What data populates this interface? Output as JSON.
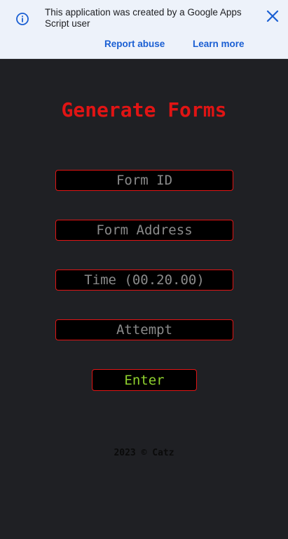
{
  "banner": {
    "message": "This application was created by a Google Apps Script user",
    "report_label": "Report abuse",
    "learn_label": "Learn more",
    "icons": {
      "info": "info-icon",
      "close": "close-icon"
    },
    "colors": {
      "background": "#edf2fa",
      "link": "#1a5fd3",
      "icon": "#1a5fd3"
    }
  },
  "form": {
    "title": "Generate Forms",
    "fields": [
      {
        "placeholder": "Form ID",
        "value": ""
      },
      {
        "placeholder": "Form Address",
        "value": ""
      },
      {
        "placeholder": "Time (00.20.00)",
        "value": ""
      },
      {
        "placeholder": "Attempt",
        "value": ""
      }
    ],
    "submit_label": "Enter",
    "colors": {
      "title": "#e01414",
      "border": "#e01414",
      "button_text": "#8fd12e",
      "page": "#1f2024"
    }
  },
  "footer": {
    "text": "2023 © Catz"
  }
}
